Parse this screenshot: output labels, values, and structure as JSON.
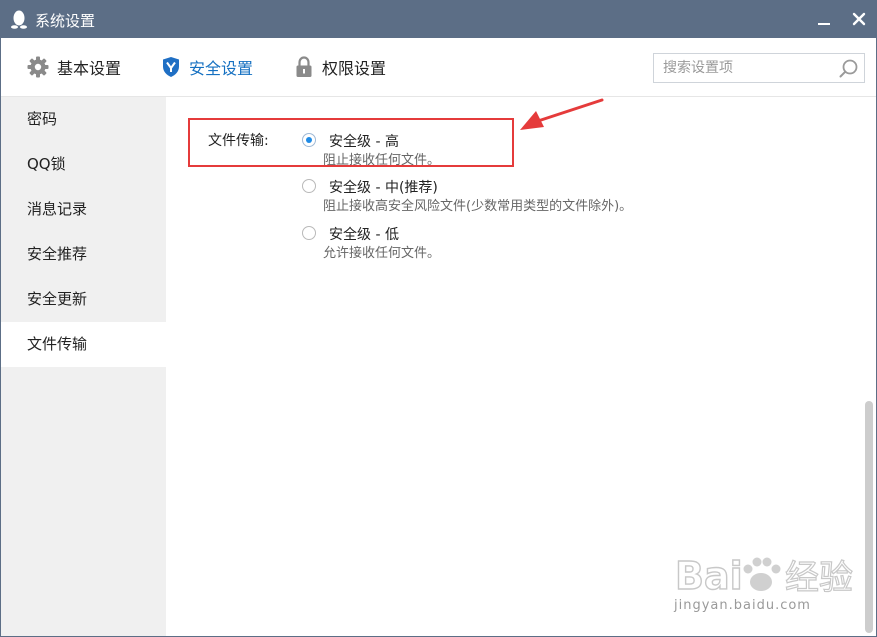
{
  "window": {
    "title": "系统设置"
  },
  "toolbar": {
    "tabs": [
      {
        "label": "基本设置",
        "icon": "gear-icon"
      },
      {
        "label": "安全设置",
        "icon": "shield-icon",
        "active": true
      },
      {
        "label": "权限设置",
        "icon": "lock-icon"
      }
    ],
    "search_placeholder": "搜索设置项"
  },
  "sidebar": {
    "items": [
      {
        "label": "密码"
      },
      {
        "label": "QQ锁"
      },
      {
        "label": "消息记录"
      },
      {
        "label": "安全推荐"
      },
      {
        "label": "安全更新"
      },
      {
        "label": "文件传输",
        "active": true
      }
    ]
  },
  "file_transfer": {
    "label": "文件传输:",
    "options": [
      {
        "label": "安全级 - 高",
        "desc": "阻止接收任何文件。",
        "selected": true
      },
      {
        "label": "安全级 - 中(推荐)",
        "desc": "阻止接收高安全风险文件(少数常用类型的文件除外)。",
        "selected": false
      },
      {
        "label": "安全级 - 低",
        "desc": "允许接收任何文件。",
        "selected": false
      }
    ]
  },
  "watermark": {
    "brand": "Baidu经验",
    "url": "jingyan.baidu.com"
  },
  "colors": {
    "titlebar": "#5c6e86",
    "accent": "#1570c1",
    "annotation": "#e53b3b",
    "sidebar_bg": "#f0f0f0"
  }
}
